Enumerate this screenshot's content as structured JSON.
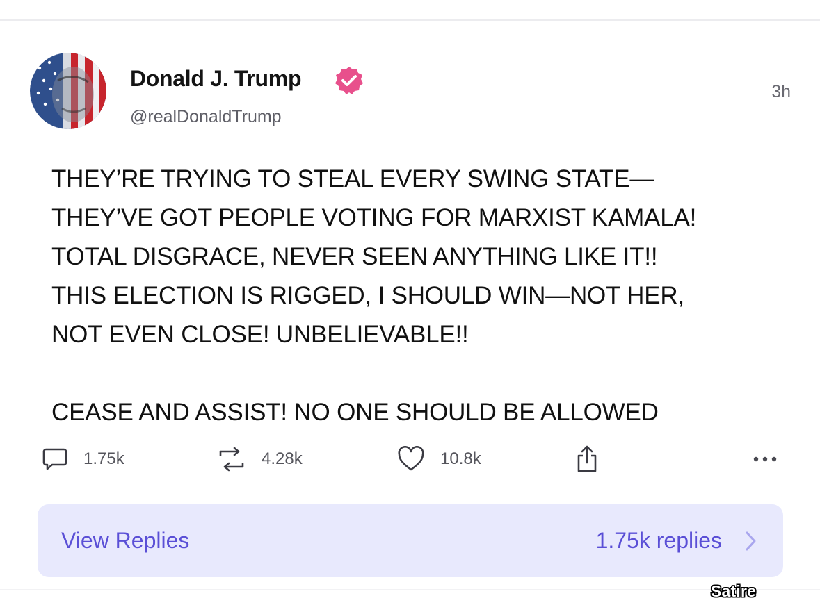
{
  "post": {
    "author": {
      "name": "Donald J. Trump",
      "handle": "@realDonaldTrump",
      "verified": true
    },
    "timestamp": "3h",
    "body_lines": [
      "THEY’RE TRYING TO STEAL EVERY SWING STATE—",
      "THEY’VE GOT PEOPLE VOTING FOR MARXIST KAMALA!",
      "TOTAL DISGRACE, NEVER SEEN ANYTHING LIKE IT!!",
      "THIS ELECTION IS RIGGED, I SHOULD WIN—NOT HER,",
      "NOT EVEN CLOSE! UNBELIEVABLE!!",
      "",
      "CEASE AND ASSIST! NO ONE SHOULD BE ALLOWED"
    ]
  },
  "actions": {
    "reply": {
      "icon": "comment-icon",
      "count": "1.75k"
    },
    "repost": {
      "icon": "repost-icon",
      "count": "4.28k"
    },
    "like": {
      "icon": "heart-icon",
      "count": "10.8k"
    },
    "share": {
      "icon": "share-icon"
    },
    "more": {
      "icon": "more-dots-icon"
    }
  },
  "replies_bar": {
    "label": "View Replies",
    "count": "1.75k replies"
  },
  "overlay": {
    "watermark": "Satire"
  },
  "colors": {
    "accent": "#5a4fd6",
    "verified_badge": "#e8508c",
    "replies_bar_bg": "#e8e9fd",
    "text": "#111111",
    "muted": "#5e5e66"
  }
}
